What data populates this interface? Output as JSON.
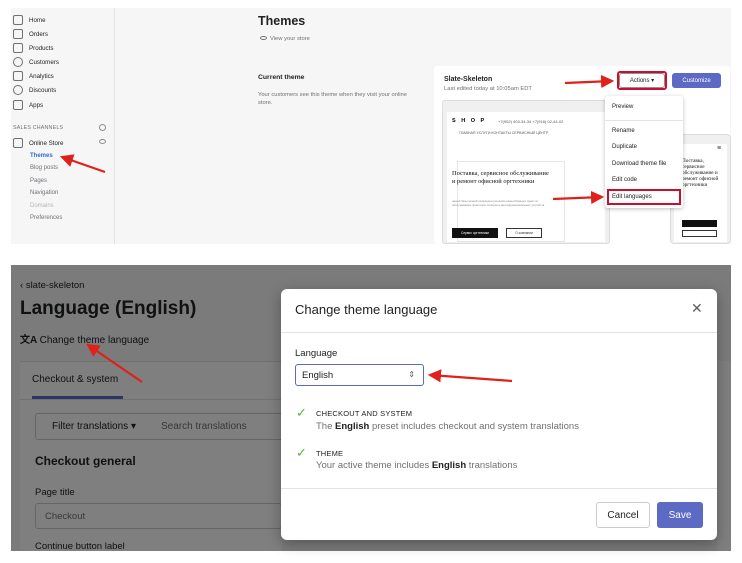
{
  "admin": {
    "nav": [
      {
        "label": "Home",
        "icon": "home-icon"
      },
      {
        "label": "Orders",
        "icon": "orders-icon"
      },
      {
        "label": "Products",
        "icon": "tag-icon"
      },
      {
        "label": "Customers",
        "icon": "person-icon"
      },
      {
        "label": "Analytics",
        "icon": "bar-chart-icon"
      },
      {
        "label": "Discounts",
        "icon": "discount-icon"
      },
      {
        "label": "Apps",
        "icon": "apps-icon"
      }
    ],
    "sales_channels_label": "SALES CHANNELS",
    "online_store_label": "Online Store",
    "sub_items": [
      "Themes",
      "Blog posts",
      "Pages",
      "Navigation",
      "Domains",
      "Preferences"
    ],
    "page_title": "Themes",
    "view_store": "View your store",
    "current_theme_title": "Current theme",
    "current_theme_desc": "Your customers see this theme when they visit your online store.",
    "theme_name": "Slate-Skeleton",
    "theme_edited": "Last edited today at 10:05am EDT",
    "actions_label": "Actions ▾",
    "customize_label": "Customize",
    "actions_menu": [
      "Preview",
      "Rename",
      "Duplicate",
      "Download theme file",
      "Edit code",
      "Edit languages"
    ],
    "preview": {
      "logo": "S H O P",
      "phones": "+7(902) 403-34-34   +7(916) 02-44-02",
      "nav": "ГЛАВНАЯ    УСЛУГИ    КОНТАКТЫ    СЕРВИСНЫЙ ЦЕНТР",
      "heading": "Поставка, сервисное обслуживание и ремонт офисной оргтехники",
      "paragraph": "нашей базы знаний посвящена решению разнообразных задач по обслуживанию принтеров, копиров и многофункциональных устройств",
      "button1": "Сервис оргтехники",
      "button2": "О компании",
      "mobile_heading": "Поставка, сервисное обслуживание и ремонт офисной оргтехники"
    }
  },
  "language_page": {
    "back_link": "slate-skeleton",
    "title": "Language (English)",
    "change_link": "Change theme language",
    "tab": "Checkout & system",
    "filter_label": "Filter translations ▾",
    "search_placeholder": "Search translations",
    "section_title": "Checkout general",
    "page_title_label": "Page title",
    "page_title_value": "Checkout",
    "continue_label": "Continue button label"
  },
  "modal": {
    "title": "Change theme language",
    "close": "✕",
    "language_label": "Language",
    "selected_language": "English",
    "items": [
      {
        "title": "CHECKOUT AND SYSTEM",
        "desc_pre": "The ",
        "desc_bold": "English",
        "desc_post": " preset includes checkout and system translations"
      },
      {
        "title": "THEME",
        "desc_pre": "Your active theme includes ",
        "desc_bold": "English",
        "desc_post": " translations"
      }
    ],
    "cancel": "Cancel",
    "save": "Save"
  },
  "colors": {
    "accent": "#5c6ac4",
    "annotation_red": "#c8102e",
    "success": "#50b83c",
    "active_link": "#2c6ecb"
  }
}
